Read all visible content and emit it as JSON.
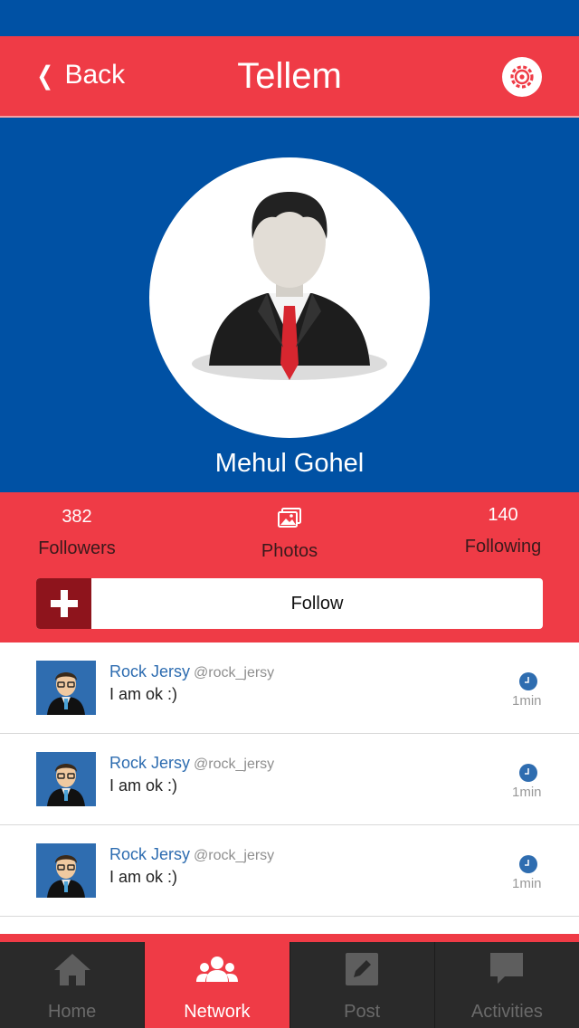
{
  "header": {
    "back_label": "Back",
    "title": "Tellem"
  },
  "profile": {
    "name": "Mehul Gohel"
  },
  "stats": {
    "followers_count": "382",
    "followers_label": "Followers",
    "photos_label": "Photos",
    "following_count": "140",
    "following_label": "Following"
  },
  "follow": {
    "label": "Follow"
  },
  "feed": [
    {
      "name": "Rock Jersy",
      "handle": "@rock_jersy",
      "text": "I am ok :)",
      "time": "1min"
    },
    {
      "name": "Rock Jersy",
      "handle": "@rock_jersy",
      "text": "I am ok :)",
      "time": "1min"
    },
    {
      "name": "Rock Jersy",
      "handle": "@rock_jersy",
      "text": "I am ok :)",
      "time": "1min"
    }
  ],
  "tabs": [
    {
      "label": "Home",
      "icon": "home-icon",
      "active": false
    },
    {
      "label": "Network",
      "icon": "users-icon",
      "active": true
    },
    {
      "label": "Post",
      "icon": "edit-icon",
      "active": false
    },
    {
      "label": "Activities",
      "icon": "chat-icon",
      "active": false
    }
  ],
  "colors": {
    "primary_blue": "#0051a4",
    "accent_red": "#ef3b46",
    "dark_red": "#8e141c",
    "link_blue": "#2d6cb0",
    "tabbar": "#2a2a2a"
  }
}
